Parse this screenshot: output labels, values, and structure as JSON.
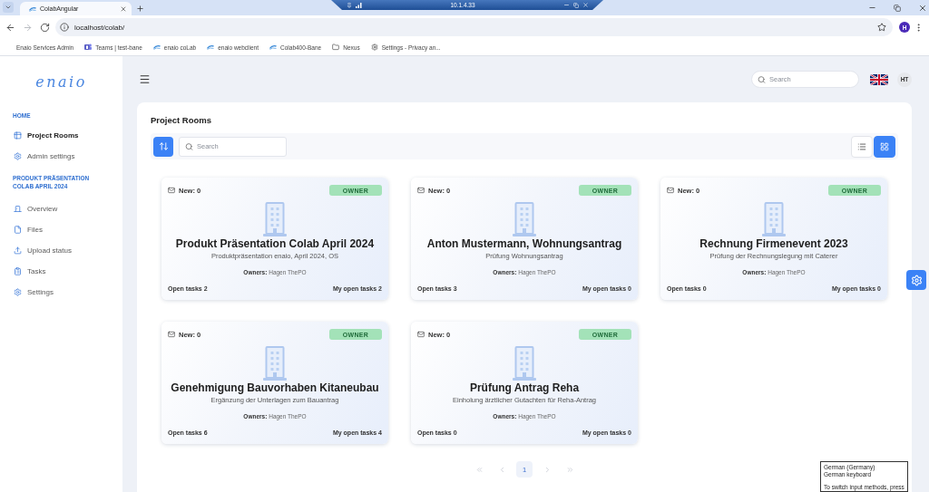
{
  "browser": {
    "tabs": [
      {
        "title": "ColabAngular",
        "selected": true
      }
    ],
    "remote_session": {
      "address": "10.1.4.33"
    },
    "nav_buttons": [
      {
        "kind": "back",
        "disabled": false
      },
      {
        "kind": "forward",
        "disabled": true
      },
      {
        "kind": "reload",
        "disabled": false
      }
    ],
    "address": "localhost/colab/",
    "profile_initial": "H",
    "bookmarks": [
      {
        "label": "Enaio Services Admin",
        "kind": "plain"
      },
      {
        "label": "Teams | test-bane",
        "kind": "teams"
      },
      {
        "label": "enaio coLab",
        "kind": "site"
      },
      {
        "label": "enaio webclient",
        "kind": "site"
      },
      {
        "label": "Colab400-Bane",
        "kind": "site"
      },
      {
        "label": "Nexus",
        "kind": "folder"
      },
      {
        "label": "Settings - Privacy an...",
        "kind": "settings"
      }
    ]
  },
  "sidebar": {
    "logo": "enaio",
    "sections": [
      {
        "heading": "HOME",
        "items": [
          {
            "label": "Project Rooms",
            "kind": "rooms",
            "selected": true
          },
          {
            "label": "Admin settings",
            "kind": "settings",
            "selected": false
          }
        ]
      },
      {
        "heading": "PRODUKT PRÄSENTATION COLAB APRIL 2024",
        "items": [
          {
            "label": "Overview",
            "kind": "overview",
            "selected": false
          },
          {
            "label": "Files",
            "kind": "files",
            "selected": false
          },
          {
            "label": "Upload status",
            "kind": "upload",
            "selected": false
          },
          {
            "label": "Tasks",
            "kind": "tasks",
            "selected": false
          },
          {
            "label": "Settings",
            "kind": "settings",
            "selected": false
          }
        ]
      }
    ]
  },
  "header": {
    "search": {
      "placeholder": "Search"
    },
    "user_initials": "HT"
  },
  "panel": {
    "title": "Project Rooms",
    "search": {
      "placeholder": "Search"
    },
    "view_modes": [
      {
        "kind": "list",
        "selected": false
      },
      {
        "kind": "grid",
        "selected": true
      }
    ],
    "rooms": [
      {
        "new": "New: 0",
        "role": "OWNER",
        "title": "Produkt Präsentation Colab April 2024",
        "description": "Produktpräsentation enaio, April 2024, OS",
        "owners": "**Owners:** Hagen ThePO",
        "open_tasks": "Open tasks 2",
        "my_open_tasks": "My open tasks 2"
      },
      {
        "new": "New: 0",
        "role": "OWNER",
        "title": "Anton Mustermann, Wohnungsantrag",
        "description": "Prüfung Wohnungsantrag",
        "owners": "**Owners:** Hagen ThePO",
        "open_tasks": "Open tasks 3",
        "my_open_tasks": "My open tasks 0"
      },
      {
        "new": "New: 0",
        "role": "OWNER",
        "title": "Rechnung Firmenevent 2023",
        "description": "Prüfung der Rechnungslegung mit Caterer",
        "owners": "**Owners:** Hagen ThePO",
        "open_tasks": "Open tasks 0",
        "my_open_tasks": "My open tasks 0"
      },
      {
        "new": "New: 0",
        "role": "OWNER",
        "title": "Genehmigung Bauvorhaben Kitaneubau",
        "description": "Ergänzung der Unterlagen zum Bauantrag",
        "owners": "**Owners:** Hagen ThePO",
        "open_tasks": "Open tasks 6",
        "my_open_tasks": "My open tasks 4"
      },
      {
        "new": "New: 0",
        "role": "OWNER",
        "title": "Prüfung Antrag Reha",
        "description": "Einholung ärztlicher Gutachten für Reha-Antrag",
        "owners": "**Owners:** Hagen ThePO",
        "open_tasks": "Open tasks 0",
        "my_open_tasks": "My open tasks 0"
      }
    ],
    "pagination": {
      "first": {
        "disabled": true
      },
      "previous": {
        "disabled": true
      },
      "pages": [
        {
          "label": "1",
          "selected": true
        }
      ],
      "next": {
        "disabled": true
      },
      "last": {
        "disabled": true
      }
    }
  },
  "input_method_popup": {
    "lines": [
      "German (Germany)",
      "German keyboard",
      "To switch input methods, press"
    ]
  }
}
